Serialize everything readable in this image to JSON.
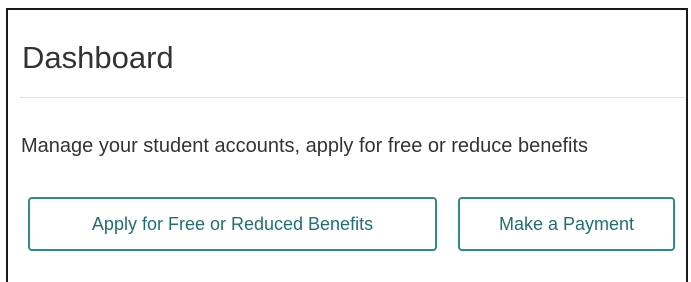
{
  "main": {
    "title": "Dashboard",
    "description": "Manage your student accounts, apply for free or reduce benefits"
  },
  "actions": {
    "apply_label": "Apply for Free or Reduced Benefits",
    "payment_label": "Make a Payment"
  },
  "colors": {
    "accent": "#2e8b8b",
    "button_text": "#1f6f73",
    "text": "#333333"
  }
}
